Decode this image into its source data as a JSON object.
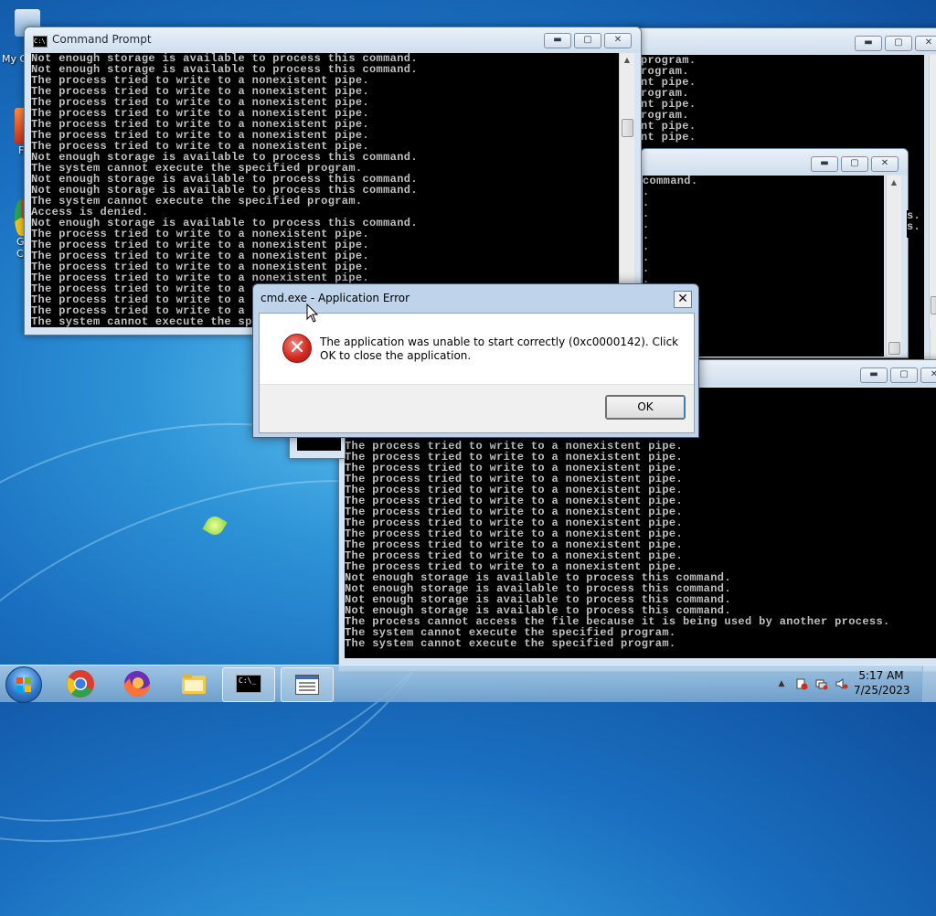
{
  "desktop": {
    "icons": [
      {
        "label": "My C",
        "icon": "computer-icon"
      },
      {
        "label": "F",
        "icon": "shortcut-icon"
      },
      {
        "label": "G\nC",
        "icon": "chrome-shortcut-icon"
      }
    ]
  },
  "windows": {
    "main": {
      "title": "Command Prompt",
      "lines": [
        "Not enough storage is available to process this command.",
        "Not enough storage is available to process this command.",
        "The process tried to write to a nonexistent pipe.",
        "The process tried to write to a nonexistent pipe.",
        "The process tried to write to a nonexistent pipe.",
        "The process tried to write to a nonexistent pipe.",
        "The process tried to write to a nonexistent pipe.",
        "The process tried to write to a nonexistent pipe.",
        "The process tried to write to a nonexistent pipe.",
        "Not enough storage is available to process this command.",
        "The system cannot execute the specified program.",
        "Not enough storage is available to process this command.",
        "Not enough storage is available to process this command.",
        "The system cannot execute the specified program.",
        "Access is denied.",
        "Not enough storage is available to process this command.",
        "The process tried to write to a nonexistent pipe.",
        "The process tried to write to a nonexistent pipe.",
        "The process tried to write to a nonexistent pipe.",
        "The process tried to write to a nonexistent pipe.",
        "The process tried to write to a nonexistent pipe.",
        "The process tried to write to a nonexistent pipe.",
        "The process tried to write to a nonexistent pipe.",
        "The process tried to write to a nonexistent pipe.",
        "The system cannot execute the specified program."
      ]
    },
    "back_right_lines": [
      "program.",
      "rogram.",
      "nt pipe.",
      "rogram.",
      "nt pipe.",
      "rogram.",
      "nt pipe.",
      "nt pipe."
    ],
    "middle_lines": [
      "command.",
      ".",
      ".",
      ".",
      ".",
      ".",
      ".",
      ".",
      ".",
      "."
    ],
    "middle_right_edge": [
      "s.",
      "s."
    ],
    "lower": {
      "lines": [
        "The process tried to write to a nonexistent pipe.",
        "The process tried to write to a nonexistent pipe.",
        "The process tried to write to a nonexistent pipe.",
        "The process tried to write to a nonexistent pipe.",
        "The process tried to write to a nonexistent pipe.",
        "The process tried to write to a nonexistent pipe.",
        "The process tried to write to a nonexistent pipe.",
        "The process tried to write to a nonexistent pipe.",
        "The process tried to write to a nonexistent pipe.",
        "The process tried to write to a nonexistent pipe.",
        "The process tried to write to a nonexistent pipe.",
        "The process tried to write to a nonexistent pipe.",
        "Not enough storage is available to process this command.",
        "Not enough storage is available to process this command.",
        "Not enough storage is available to process this command.",
        "Not enough storage is available to process this command.",
        "The process cannot access the file because it is being used by another process.",
        "The system cannot execute the specified program.",
        "The system cannot execute the specified program."
      ]
    }
  },
  "dialog": {
    "title": "cmd.exe - Application Error",
    "close_glyph": "✕",
    "icon_glyph": "✕",
    "message": "The application was unable to start correctly (0xc0000142). Click OK to close the application.",
    "ok_label": "OK"
  },
  "window_controls": {
    "minimize": "▬",
    "maximize": "▢",
    "close": "✕"
  },
  "taskbar": {
    "items": [
      {
        "name": "start-button",
        "icon": "windows-logo-icon"
      },
      {
        "name": "chrome",
        "icon": "chrome-icon"
      },
      {
        "name": "firefox",
        "icon": "firefox-icon"
      },
      {
        "name": "explorer",
        "icon": "folder-icon"
      },
      {
        "name": "cmd",
        "icon": "cmd-icon",
        "glyph": "C:\\_"
      },
      {
        "name": "app",
        "icon": "window-icon"
      }
    ],
    "tray": {
      "time": "5:17 AM",
      "date": "7/25/2023",
      "icons": [
        "show-hidden-icons-icon",
        "action-center-icon",
        "network-icon",
        "volume-icon"
      ],
      "show_hidden_glyph": "▲"
    }
  },
  "colors": {
    "console_bg": "#000000",
    "console_text": "#c0c0c0",
    "error_red": "#d42a22",
    "desktop_blue": "#1a6fc0"
  }
}
